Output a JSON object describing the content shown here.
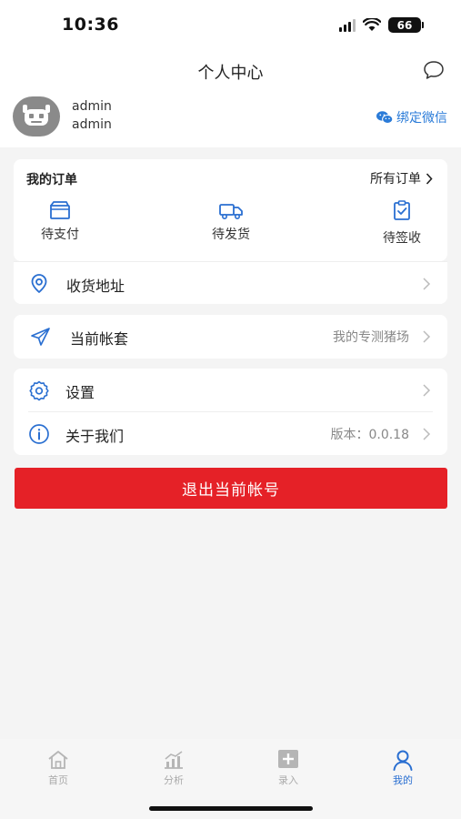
{
  "status_bar": {
    "time": "10:36",
    "battery": "66"
  },
  "header": {
    "title": "个人中心"
  },
  "profile": {
    "name": "admin",
    "account": "admin",
    "bind_label": "绑定微信"
  },
  "orders": {
    "title": "我的订单",
    "all_label": "所有订单",
    "items": [
      {
        "label": "待支付",
        "icon": "wallet-icon"
      },
      {
        "label": "待发货",
        "icon": "truck-icon"
      },
      {
        "label": "待签收",
        "icon": "clipboard-check-icon"
      }
    ]
  },
  "menu": {
    "address": {
      "label": "收货地址",
      "icon": "location-icon"
    },
    "account_set": {
      "label": "当前帐套",
      "value": "我的专测猪场",
      "icon": "send-icon"
    },
    "settings": {
      "label": "设置",
      "icon": "gear-icon"
    },
    "about": {
      "label": "关于我们",
      "value": "版本：0.0.18",
      "icon": "info-icon"
    }
  },
  "logout_label": "退出当前帐号",
  "tabs": [
    {
      "label": "首页",
      "icon": "home-icon",
      "active": false
    },
    {
      "label": "分析",
      "icon": "chart-icon",
      "active": false
    },
    {
      "label": "录入",
      "icon": "plus-square-icon",
      "active": false
    },
    {
      "label": "我的",
      "icon": "user-icon",
      "active": true
    }
  ],
  "colors": {
    "accent": "#2a6fd1",
    "danger": "#e52127",
    "wechat": "#2a7bd8"
  }
}
